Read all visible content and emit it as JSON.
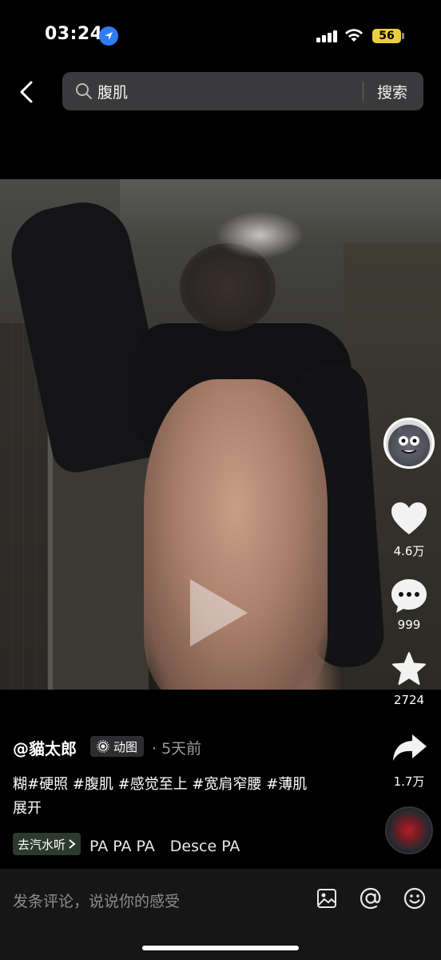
{
  "status_bar": {
    "time": "03:24",
    "battery": "56"
  },
  "search": {
    "query": "腹肌",
    "button": "搜索"
  },
  "rail": {
    "likes": "4.6万",
    "comments": "999",
    "favorites": "2724",
    "shares": "1.7万"
  },
  "post": {
    "author": "@貓太郎",
    "badge": "动图",
    "time_ago": "· 5天前",
    "tags": "糊#硬照 #腹肌 #感觉至上 #宽肩窄腰 #薄肌",
    "expand": "展开"
  },
  "music": {
    "chip": "去汽水听",
    "text": "PA PA PA　Desce PA"
  },
  "comment_placeholder": "发条评论，说说你的感受",
  "colors": {
    "accent_blue": "#2f7cf6",
    "battery": "#e9cf3c",
    "search_bg": "#3a3a3c"
  }
}
